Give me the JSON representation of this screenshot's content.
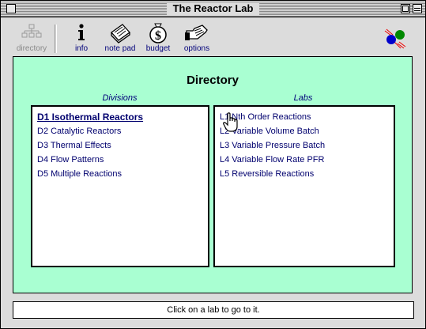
{
  "window": {
    "title": "The Reactor Lab"
  },
  "toolbar": {
    "directory_label": "directory",
    "info_label": "info",
    "notepad_label": "note pad",
    "budget_label": "budget",
    "options_label": "options"
  },
  "main": {
    "heading": "Directory",
    "divisions_label": "Divisions",
    "labs_label": "Labs",
    "divisions": [
      "D1  Isothermal Reactors",
      "D2 Catalytic Reactors",
      "D3 Thermal Effects",
      "D4 Flow Patterns",
      "D5 Multiple Reactions"
    ],
    "labs": [
      "L1 Nth Order Reactions",
      "L2 Variable Volume Batch",
      "L3 Variable Pressure Batch",
      "L4 Variable Flow Rate PFR",
      "L5 Reversible Reactions"
    ]
  },
  "status": {
    "message": "Click on a lab to go to it."
  },
  "colors": {
    "panel_bg": "#a9ffd2",
    "link_text": "#00006e",
    "disabled_text": "#8a8a8a"
  },
  "icons": [
    "close-box",
    "zoom-box",
    "collapse-box",
    "directory-icon",
    "info-icon",
    "notepad-icon",
    "budget-icon",
    "options-icon",
    "molecule-logo-icon",
    "hand-pointer-cursor"
  ]
}
